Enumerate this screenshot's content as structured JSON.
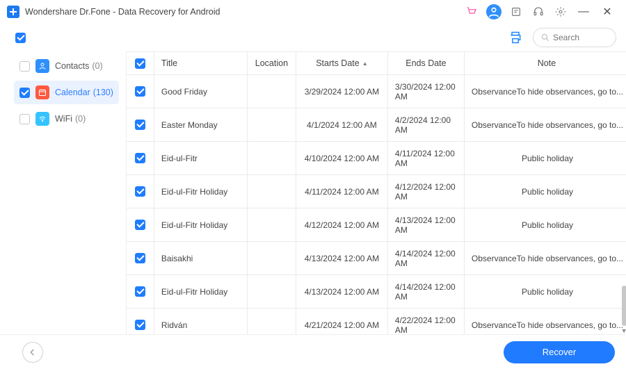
{
  "app_title": "Wondershare Dr.Fone - Data Recovery for Android",
  "search": {
    "placeholder": "Search"
  },
  "sidebar": {
    "items": [
      {
        "key": "contacts",
        "label": "Contacts",
        "count_text": "(0)",
        "checked": false,
        "selected": false
      },
      {
        "key": "calendar",
        "label": "Calendar",
        "count_text": "(130)",
        "checked": true,
        "selected": true
      },
      {
        "key": "wifi",
        "label": "WiFi",
        "count_text": "(0)",
        "checked": false,
        "selected": false
      }
    ]
  },
  "table": {
    "headers": {
      "title": "Title",
      "location": "Location",
      "starts_date": "Starts Date",
      "ends_date": "Ends Date",
      "note": "Note"
    },
    "sort_column": "starts_date",
    "rows": [
      {
        "checked": true,
        "title": "Good Friday",
        "location": "",
        "starts": "3/29/2024 12:00 AM",
        "ends": "3/30/2024 12:00 AM",
        "note": "ObservanceTo hide observances, go to..."
      },
      {
        "checked": true,
        "title": "Easter Monday",
        "location": "",
        "starts": "4/1/2024 12:00 AM",
        "ends": "4/2/2024 12:00 AM",
        "note": "ObservanceTo hide observances, go to..."
      },
      {
        "checked": true,
        "title": "Eid-ul-Fitr",
        "location": "",
        "starts": "4/10/2024 12:00 AM",
        "ends": "4/11/2024 12:00 AM",
        "note": "Public holiday"
      },
      {
        "checked": true,
        "title": "Eid-ul-Fitr Holiday",
        "location": "",
        "starts": "4/11/2024 12:00 AM",
        "ends": "4/12/2024 12:00 AM",
        "note": "Public holiday"
      },
      {
        "checked": true,
        "title": "Eid-ul-Fitr Holiday",
        "location": "",
        "starts": "4/12/2024 12:00 AM",
        "ends": "4/13/2024 12:00 AM",
        "note": "Public holiday"
      },
      {
        "checked": true,
        "title": "Baisakhi",
        "location": "",
        "starts": "4/13/2024 12:00 AM",
        "ends": "4/14/2024 12:00 AM",
        "note": "ObservanceTo hide observances, go to..."
      },
      {
        "checked": true,
        "title": "Eid-ul-Fitr Holiday",
        "location": "",
        "starts": "4/13/2024 12:00 AM",
        "ends": "4/14/2024 12:00 AM",
        "note": "Public holiday"
      },
      {
        "checked": true,
        "title": "Ridván",
        "location": "",
        "starts": "4/21/2024 12:00 AM",
        "ends": "4/22/2024 12:00 AM",
        "note": "ObservanceTo hide observances, go to..."
      }
    ]
  },
  "footer": {
    "recover_label": "Recover"
  }
}
